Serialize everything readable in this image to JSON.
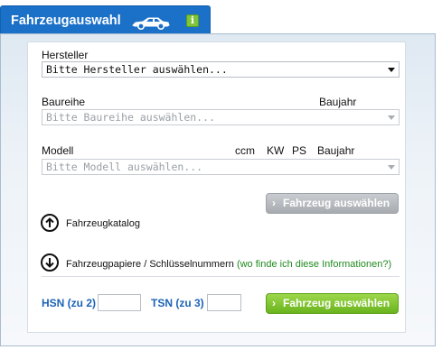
{
  "header": {
    "title": "Fahrzeugauswahl",
    "car_icon": "car-icon",
    "info_icon": "info-icon",
    "info_symbol": "i"
  },
  "form": {
    "manufacturer_label": "Hersteller",
    "manufacturer_value": "Bitte Hersteller auswählen...",
    "series_label": "Baureihe",
    "series_year_label": "Baujahr",
    "series_value": "Bitte Baureihe auswählen...",
    "model_label": "Modell",
    "model_cols": {
      "ccm": "ccm",
      "kw": "KW",
      "ps": "PS",
      "year": "Baujahr"
    },
    "model_value": "Bitte Modell auswählen...",
    "select_vehicle_button": "Fahrzeug auswählen"
  },
  "catalog": {
    "label": "Fahrzeugkatalog",
    "icon": "arrow-up-circle-icon"
  },
  "papers": {
    "label": "Fahrzeugpapiere / Schlüsselnummern",
    "help_link": "(wo finde ich diese Informationen?)",
    "icon": "arrow-down-circle-icon"
  },
  "keys": {
    "hsn_label": "HSN (zu 2)",
    "hsn_value": "",
    "tsn_label": "TSN (zu 3)",
    "tsn_value": "",
    "submit_button": "Fahrzeug auswählen"
  },
  "colors": {
    "tab_blue": "#1b70c8",
    "green_button": "#7cc233",
    "gray_button": "#b4b8bd",
    "label_blue": "#1b63b8",
    "link_green": "#1f8b1f"
  }
}
